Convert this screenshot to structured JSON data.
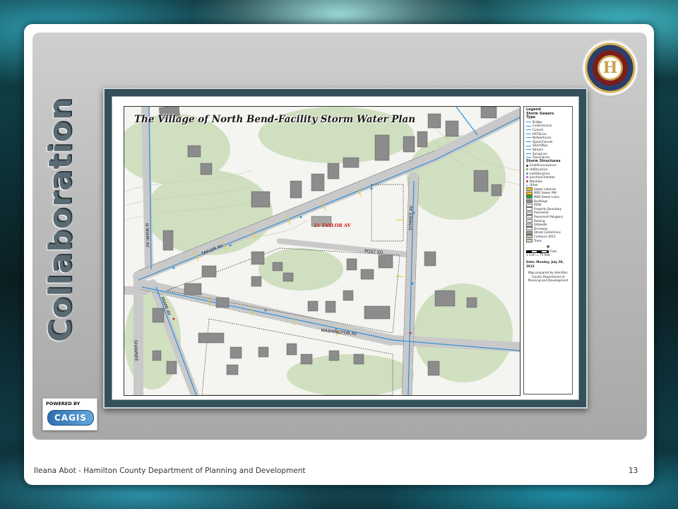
{
  "slide": {
    "title": "Collaboration",
    "footer_left": "Ileana Abot - Hamilton County Department of Planning and Development",
    "page_number": "13"
  },
  "logos": {
    "seal_letter": "H",
    "cagis_powered_by": "POWERED BY",
    "cagis_name": "CAGIS"
  },
  "map": {
    "title": "The Village of North Bend-Facility Storm Water Plan",
    "address_label": "21 TAYLOR AV",
    "streets": {
      "taylor": "TAYLOR AV",
      "washington": "WASHINGTON AV",
      "symmes": "SYMMES AV",
      "miami": "MIAMI AV",
      "shawnee": "SHAWNEE",
      "post": "POST SQ",
      "nmiami": "N MIAMI AV"
    },
    "colors": {
      "road": "#c9c9c9",
      "trees": "#c9dcb7",
      "building": "#8c8c8c",
      "stream": "#2f8fd8",
      "address": "#dd1111"
    }
  },
  "legend": {
    "title": "Legend",
    "storm_sewers": "Storm Sewers",
    "type_label": "Type",
    "sewer_types": [
      "Bridge",
      "CollectorLine",
      "Culvert",
      "HSTSLine",
      "NetworkLine",
      "OpenChannel",
      "StormPipe",
      "Stream",
      "SumpLine",
      "Trenchdrain"
    ],
    "storm_structures": "Storm Structures",
    "structure_types": [
      "EndofConveyance",
      "HdStructure",
      "InletStructure",
      "JunctionChamber",
      "Manhole",
      "Other"
    ],
    "other_layers": [
      "Sewer Laterals",
      "MSD Sewer MH",
      "MSD Sewer Lines",
      "Buildings",
      "ROW",
      "Property Boundary",
      "Pavement",
      "Pavement Polygons",
      "Parking",
      "Sidewalk",
      "Driveway",
      "Street Centerlines",
      "Contours 2011",
      "Trees"
    ],
    "scale_feet": "Feet",
    "scale_ratio": "1 inch = 75 feet",
    "date": "Date: Monday, July 29, 2013",
    "prepared_by": "Map prepared by Hamilton County Department of Planning and Development"
  }
}
